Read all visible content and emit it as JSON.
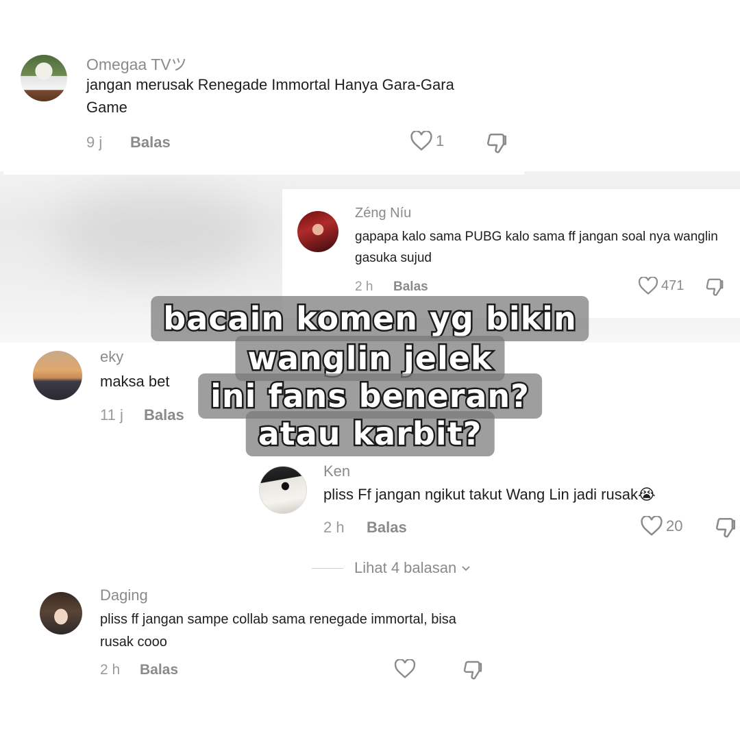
{
  "comments": [
    {
      "username": "Omegaa TVツ",
      "text": "jangan merusak Renegade Immortal Hanya Gara-Gara Game",
      "time": "9 j",
      "reply": "Balas",
      "likes": "1"
    },
    {
      "username": "Zéng Níu",
      "text": "gapapa kalo sama PUBG kalo sama ff jangan soal nya wanglin gasuka sujud",
      "time": "2 h",
      "reply": "Balas",
      "likes": "471"
    },
    {
      "username": "eky",
      "text": "maksa bet",
      "time": "11 j",
      "reply": "Balas",
      "likes": ""
    },
    {
      "username": "Ken",
      "text": "pliss Ff jangan ngikut takut Wang Lin jadi rusak😭",
      "time": "2 h",
      "reply": "Balas",
      "likes": "20"
    },
    {
      "username": "Daging",
      "text": "pliss ff jangan sampe collab sama renegade immortal, bisa rusak cooo",
      "time": "2 h",
      "reply": "Balas",
      "likes": ""
    }
  ],
  "view_replies": "Lihat 4 balasan",
  "overlay": {
    "line1": "bacain komen yg bikin",
    "line2": "wanglin jelek",
    "line3": "ini fans beneran?",
    "line4": "atau karbit?"
  },
  "icons": {
    "like": "heart-outline-icon",
    "dislike": "thumbs-down-icon",
    "chevron": "chevron-down-icon"
  }
}
